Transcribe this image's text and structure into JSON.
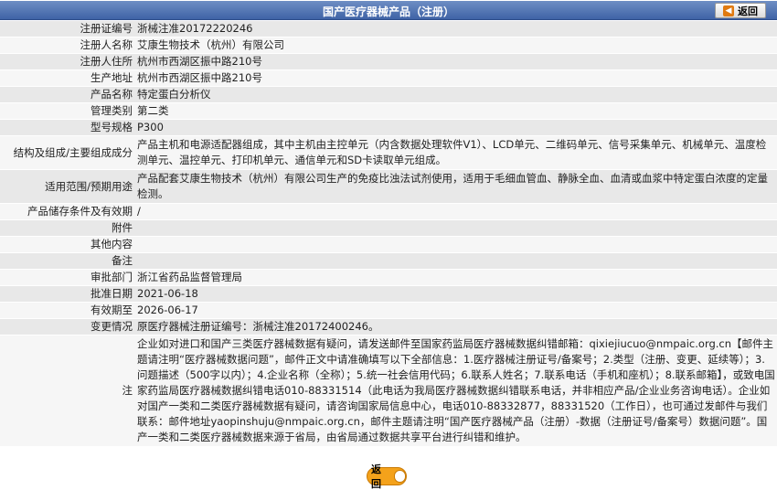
{
  "header": {
    "title": "国产医疗器械产品（注册）",
    "back_label": "返回"
  },
  "rows": [
    {
      "label": "注册证编号",
      "value": "浙械注准20172220246"
    },
    {
      "label": "注册人名称",
      "value": "艾康生物技术（杭州）有限公司"
    },
    {
      "label": "注册人住所",
      "value": "杭州市西湖区振中路210号"
    },
    {
      "label": "生产地址",
      "value": "杭州市西湖区振中路210号"
    },
    {
      "label": "产品名称",
      "value": "特定蛋白分析仪"
    },
    {
      "label": "管理类别",
      "value": "第二类"
    },
    {
      "label": "型号规格",
      "value": "P300"
    },
    {
      "label": "结构及组成/主要组成成分",
      "value": "产品主机和电源适配器组成，其中主机由主控单元（内含数据处理软件V1）、LCD单元、二维码单元、信号采集单元、机械单元、温度检测单元、温控单元、打印机单元、通信单元和SD卡读取单元组成。"
    },
    {
      "label": "适用范围/预期用途",
      "value": "产品配套艾康生物技术（杭州）有限公司生产的免疫比浊法试剂使用，适用于毛细血管血、静脉全血、血清或血浆中特定蛋白浓度的定量检测。"
    },
    {
      "label": "产品储存条件及有效期",
      "value": "/"
    },
    {
      "label": "附件",
      "value": ""
    },
    {
      "label": "其他内容",
      "value": ""
    },
    {
      "label": "备注",
      "value": ""
    },
    {
      "label": "审批部门",
      "value": "浙江省药品监督管理局"
    },
    {
      "label": "批准日期",
      "value": "2021-06-18"
    },
    {
      "label": "有效期至",
      "value": "2026-06-17"
    },
    {
      "label": "变更情况",
      "value": "原医疗器械注册证编号：浙械注准20172400246。"
    },
    {
      "label": "注",
      "value": "企业如对进口和国产三类医疗器械数据有疑问，请发送邮件至国家药监局医疗器械数据纠错邮箱：qixiejiucuo@nmpaic.org.cn【邮件主题请注明“医疗器械数据问题”，邮件正文中请准确填写以下全部信息：1.医疗器械注册证号/备案号；2.类型（注册、变更、延续等）；3.问题描述（500字以内）；4.企业名称（全称）；5.统一社会信用代码；6.联系人姓名；7.联系电话（手机和座机）；8.联系邮箱】，或致电国家药监局医疗器械数据纠错电话010-88331514（此电话为我局医疗器械数据纠错联系电话，并非相应产品/企业业务咨询电话）。企业如对国产一类和二类医疗器械数据有疑问，请咨询国家局信息中心，电话010-88332877，88331520（工作日），也可通过发邮件与我们联系：邮件地址yaopinshuju@nmpaic.org.cn，邮件主题请注明“国产医疗器械产品（注册）-数据（注册证号/备案号）数据问题”。国产一类和二类医疗器械数据来源于省局，由省局通过数据共享平台进行纠错和维护。"
    }
  ],
  "footer": {
    "back_label": "返回"
  }
}
